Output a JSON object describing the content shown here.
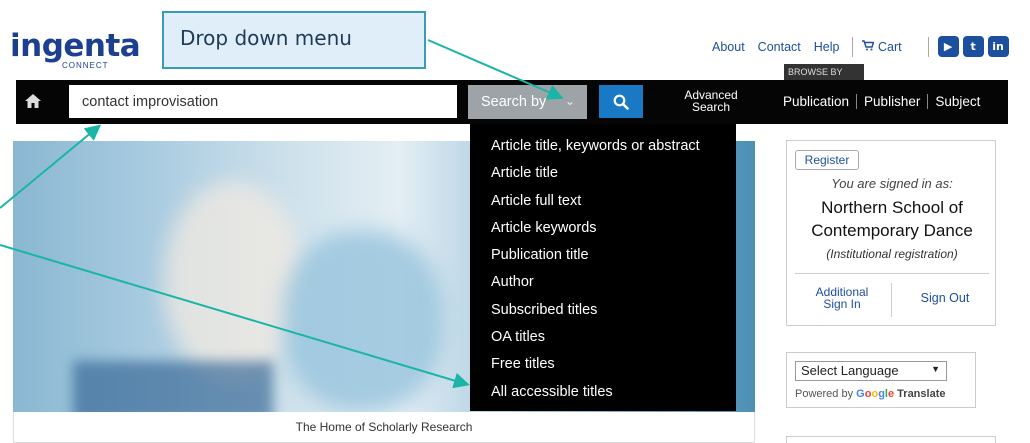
{
  "header": {
    "logo_text": "ingenta",
    "logo_sub": "CONNECT",
    "callout_text": "Drop down menu",
    "links": [
      "About",
      "Contact",
      "Help"
    ],
    "cart_label": "Cart",
    "social_icons": [
      "youtube-icon",
      "twitter-icon",
      "linkedin-icon"
    ],
    "browse_tab": "BROWSE BY"
  },
  "navbar": {
    "search_value": "contact improvisation",
    "search_by_label": "Search by",
    "advanced_line1": "Advanced",
    "advanced_line2": "Search",
    "browse_links": [
      "Publication",
      "Publisher",
      "Subject"
    ]
  },
  "dropdown": {
    "options": [
      "Article title, keywords or abstract",
      "Article title",
      "Article full text",
      "Article keywords",
      "Publication title",
      "Author",
      "Subscribed titles",
      "OA titles",
      "Free titles",
      "All accessible titles"
    ]
  },
  "hero": {
    "caption": "The Home of Scholarly Research"
  },
  "account": {
    "register_label": "Register",
    "signed_in_text": "You are signed in as:",
    "org_line1": "Northern School of",
    "org_line2": "Contemporary Dance",
    "registration_type": "(Institutional registration)",
    "additional_line1": "Additional",
    "additional_line2": "Sign In",
    "sign_out_label": "Sign Out"
  },
  "language": {
    "select_value": "Select Language",
    "powered_by": "Powered by",
    "google": "Google",
    "translate": "Translate"
  },
  "colors": {
    "brand_blue": "#1d3f8f",
    "nav_black": "#050505",
    "search_button": "#1979c4",
    "annotation": "#19b5a6"
  }
}
